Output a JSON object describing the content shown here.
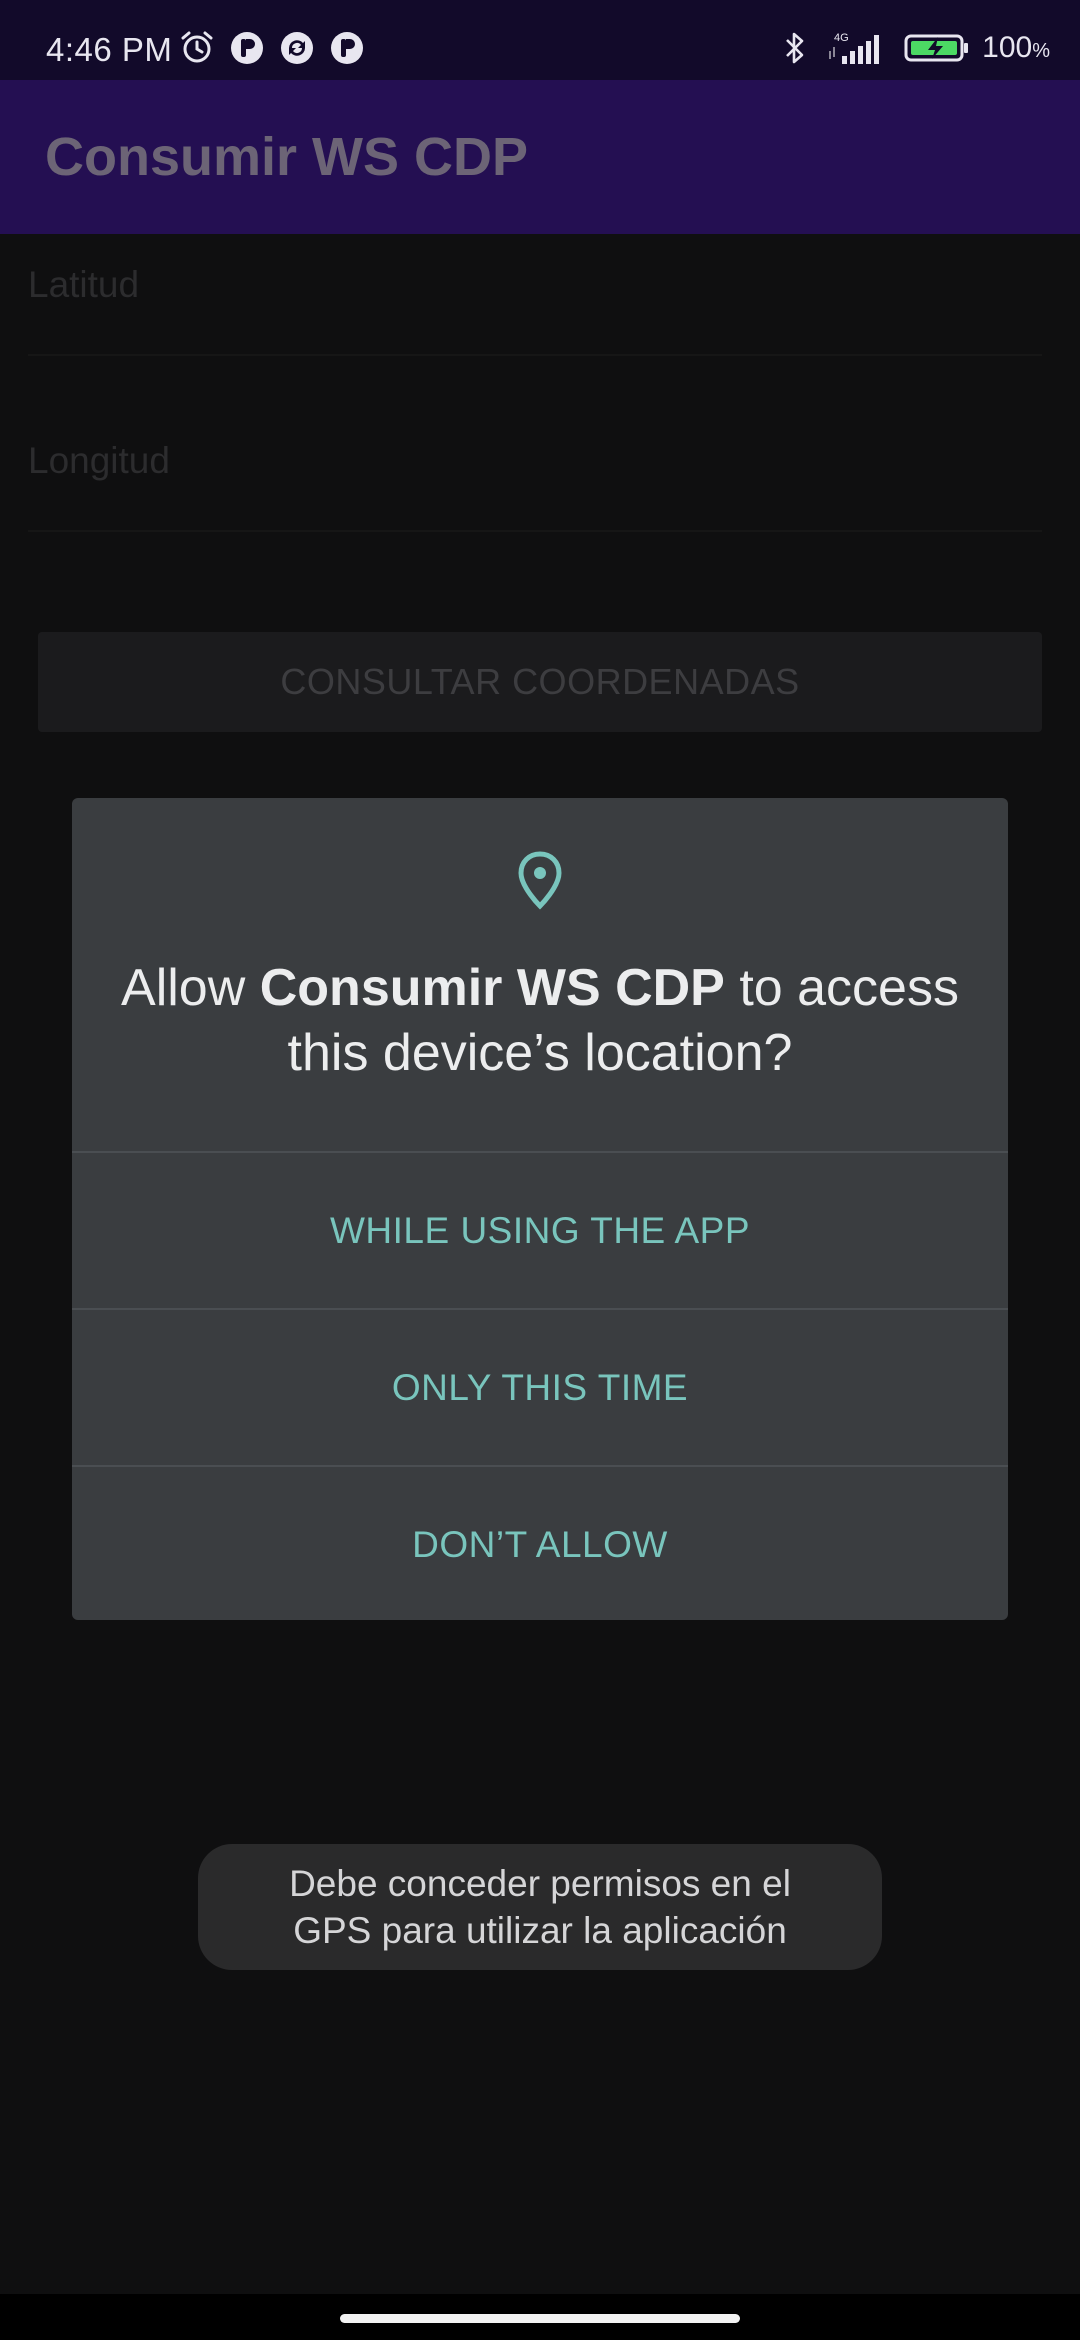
{
  "status_bar": {
    "time": "4:46 PM",
    "left_icons": [
      "alarm-icon",
      "app-notification-icon",
      "sync-notification-icon",
      "app-notification-icon"
    ],
    "network": "4G",
    "battery_percent": "100",
    "battery_unit": "%"
  },
  "app_bar": {
    "title": "Consumir WS CDP"
  },
  "form": {
    "latitude_label": "Latitud",
    "longitude_label": "Longitud",
    "consult_button_label": "CONSULTAR COORDENADAS"
  },
  "dialog": {
    "icon": "location-pin-icon",
    "title_prefix": "Allow ",
    "app_name": "Consumir WS CDP",
    "title_suffix": " to access this device’s location?",
    "buttons": [
      {
        "label": "WHILE USING THE APP"
      },
      {
        "label": "ONLY THIS TIME"
      },
      {
        "label": "DON’T ALLOW"
      }
    ]
  },
  "toast": {
    "message": "Debe conceder permisos en el GPS para utilizar la aplicación"
  },
  "colors": {
    "status_bar_bg": "#120a2a",
    "app_bar_bg": "#240f52",
    "dialog_bg": "#3a3d40",
    "dialog_accent": "#79c5bd",
    "toast_bg": "#2a2a2b"
  }
}
